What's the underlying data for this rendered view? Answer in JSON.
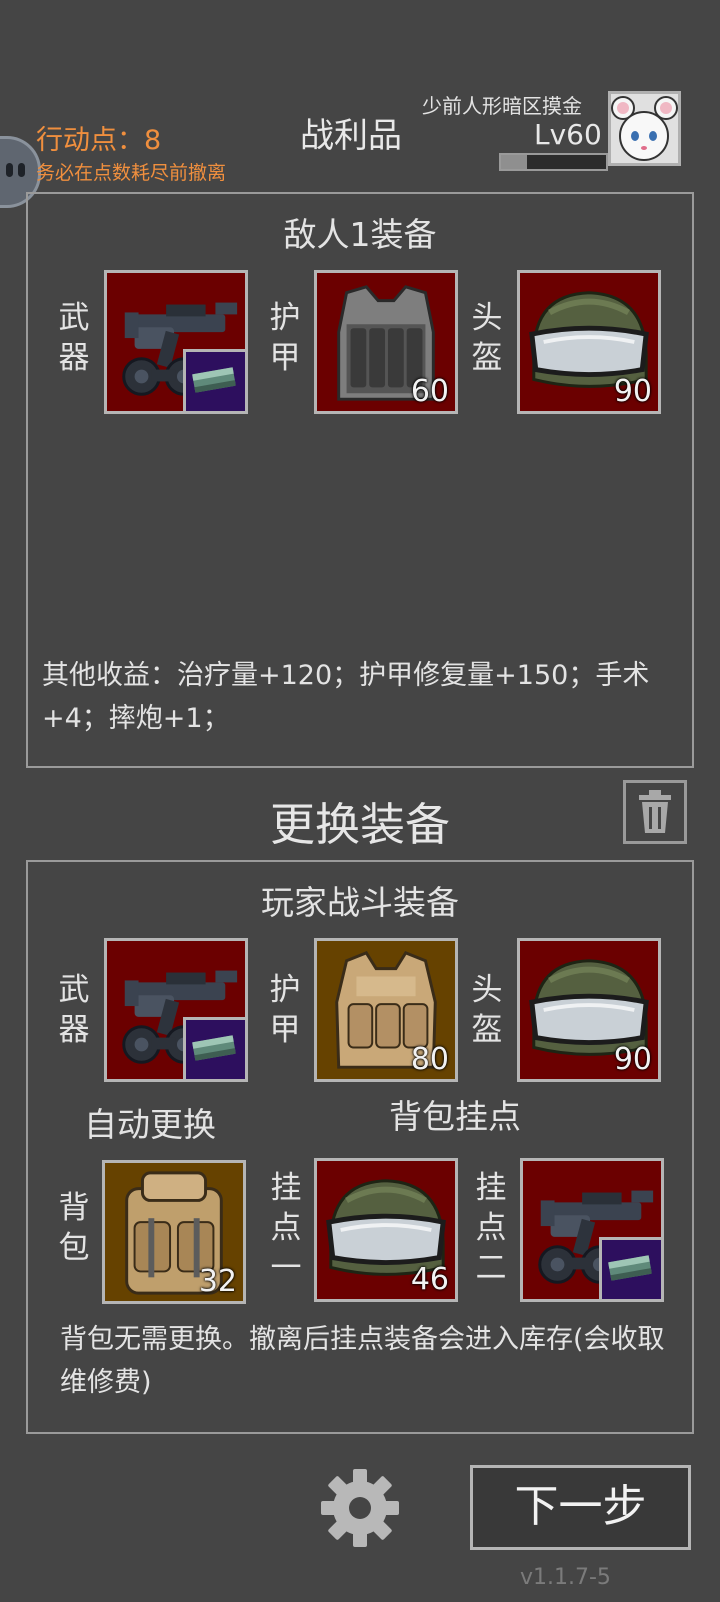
{
  "status": {
    "action_points": "行动点：8",
    "warning": "务必在点数耗尽前撤离"
  },
  "header": {
    "title": "战利品",
    "player_name": "少前人形暗区摸金",
    "level": "Lv60",
    "xp_progress": 0.25
  },
  "enemy_panel": {
    "title": "敌人1装备",
    "slots": {
      "weapon": {
        "label": "武器",
        "icon": "smg-icon",
        "ammo_icon": "ammo-box-icon"
      },
      "armor": {
        "label": "护甲",
        "icon": "gray-vest-icon",
        "durability": "60"
      },
      "helmet": {
        "label": "头盔",
        "icon": "green-helmet-icon",
        "durability": "90"
      }
    },
    "other_gains": "其他收益：治疗量+120；护甲修复量+150；手术+4；摔炮+1；"
  },
  "swap_title": "更换装备",
  "player_panel": {
    "title": "玩家战斗装备",
    "slots": {
      "weapon": {
        "label": "武器",
        "icon": "smg-icon",
        "ammo_icon": "ammo-box-icon"
      },
      "armor": {
        "label": "护甲",
        "icon": "tan-vest-icon",
        "durability": "80"
      },
      "helmet": {
        "label": "头盔",
        "icon": "green-helmet-icon",
        "durability": "90"
      }
    },
    "auto_swap_label": "自动更换",
    "backpack_mounts_label": "背包挂点",
    "backpack": {
      "label": "背包",
      "icon": "backpack-icon",
      "durability": "32"
    },
    "mount1": {
      "label": "挂点一",
      "icon": "green-helmet-icon",
      "durability": "46"
    },
    "mount2": {
      "label": "挂点二",
      "icon": "smg-icon",
      "ammo_icon": "ammo-box-icon"
    },
    "note": "背包无需更换。撤离后挂点装备会进入库存(会收取维修费)"
  },
  "footer": {
    "next_label": "下一步",
    "version": "v1.1.7-5"
  }
}
